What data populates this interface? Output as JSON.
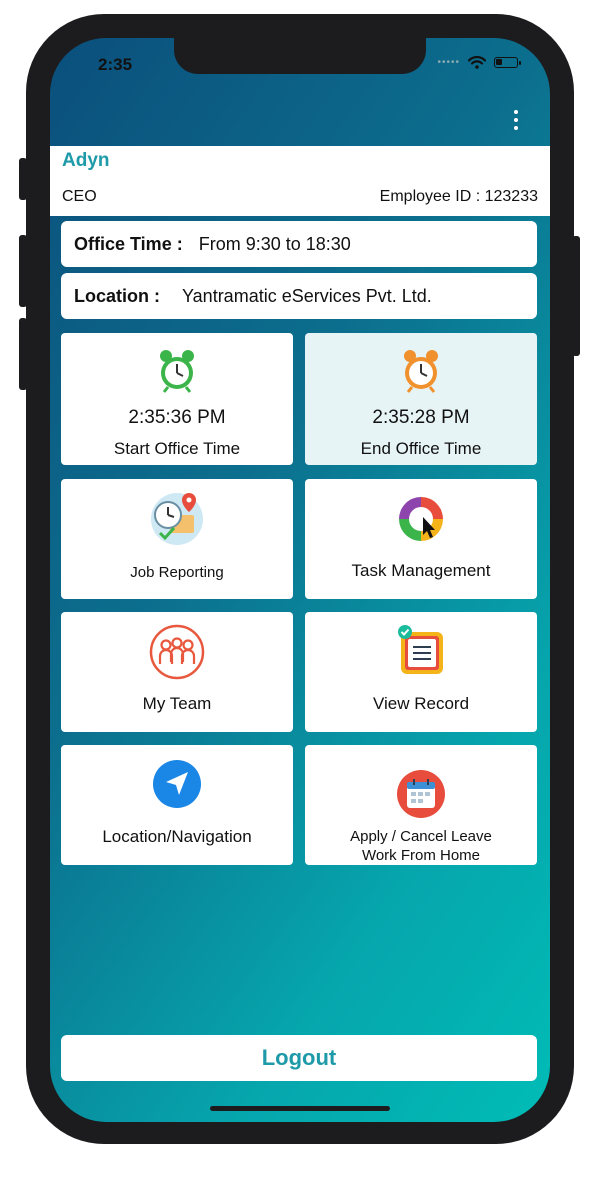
{
  "status_bar": {
    "time": "2:35"
  },
  "profile": {
    "name": "Adyn",
    "role": "CEO",
    "employee_id": "Employee ID : 123233"
  },
  "office_time": {
    "label": "Office Time :",
    "value": "From 9:30 to 18:30"
  },
  "location": {
    "label": "Location :",
    "value": "Yantramatic eServices Pvt. Ltd."
  },
  "tiles": {
    "start": {
      "time": "2:35:36 PM",
      "label": "Start  Office Time",
      "icon": "alarm-clock-green-icon"
    },
    "end": {
      "time": "2:35:28 PM",
      "label": "End  Office Time",
      "icon": "alarm-clock-orange-icon"
    },
    "job_reporting": {
      "label": "Job Reporting",
      "icon": "job-reporting-icon"
    },
    "task_management": {
      "label": "Task Management",
      "icon": "task-management-icon"
    },
    "my_team": {
      "label": "My Team",
      "icon": "team-icon"
    },
    "view_record": {
      "label": "View Record",
      "icon": "clipboard-icon"
    },
    "location_navigation": {
      "label": "Location/Navigation",
      "icon": "navigation-arrow-icon"
    },
    "leave": {
      "line1": "Apply / Cancel Leave",
      "line2": "Work From Home",
      "icon": "calendar-icon"
    }
  },
  "logout_label": "Logout",
  "colors": {
    "accent": "#1e9aa8",
    "gradient_start": "#0b4f7c",
    "gradient_end": "#00bcb6"
  }
}
